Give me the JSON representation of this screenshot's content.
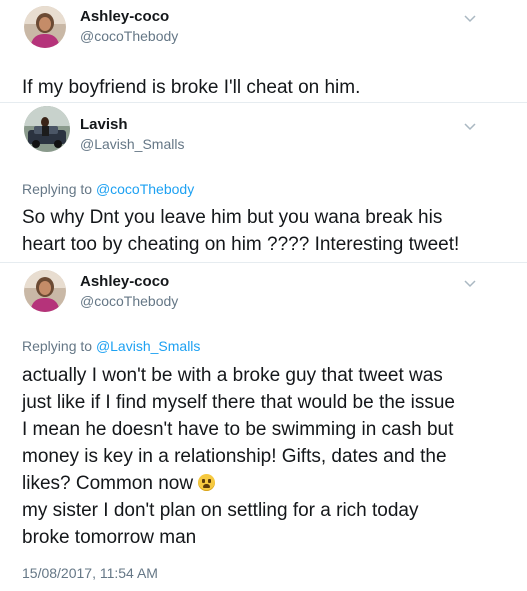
{
  "tweet1": {
    "name": "Ashley-coco",
    "handle": "@cocoThebody",
    "text": "If my boyfriend is broke I'll cheat on him.",
    "menu_icon": "chevron-down-icon"
  },
  "tweet2": {
    "name": "Lavish",
    "handle": "@Lavish_Smalls",
    "replying_prefix": "Replying to ",
    "replying_to": "@cocoThebody",
    "lines": [
      "So why Dnt you leave him but you wana break his",
      "heart too by cheating on him ???? Interesting tweet!"
    ],
    "menu_icon": "chevron-down-icon"
  },
  "tweet3": {
    "name": "Ashley-coco",
    "handle": "@cocoThebody",
    "replying_prefix": "Replying to ",
    "replying_to": "@Lavish_Smalls",
    "lines": [
      "actually I won't be with a broke guy that tweet was",
      "just like if I find myself there that would be the issue",
      "I mean he doesn't have to be swimming in cash but",
      "money is key in a relationship! Gifts, dates and the",
      "likes? Common now",
      "my sister I don't plan on settling for a rich today",
      "broke tomorrow man"
    ],
    "emoji": "weary-face-emoji",
    "timestamp": "15/08/2017, 11:54 AM",
    "menu_icon": "chevron-down-icon"
  }
}
